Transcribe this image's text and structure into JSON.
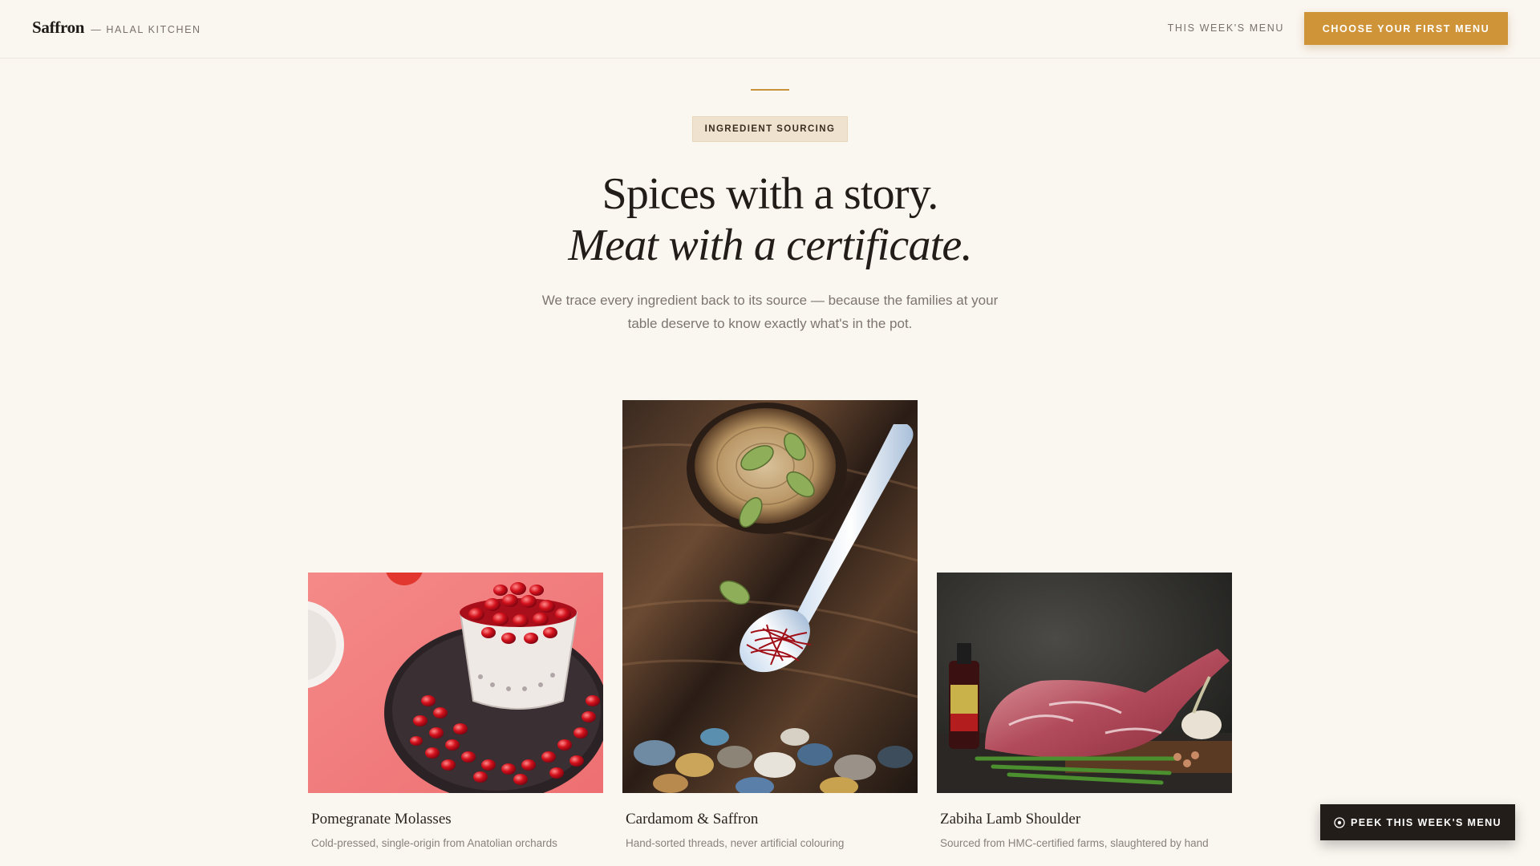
{
  "header": {
    "brand": "Saffron",
    "tagline": "— HALAL KITCHEN",
    "nav_link": "THIS WEEK'S MENU",
    "cta": "CHOOSE YOUR FIRST MENU"
  },
  "hero": {
    "badge": "INGREDIENT SOURCING",
    "headline_line1": "Spices with a story.",
    "headline_line2": "Meat with a certificate.",
    "lede": "We trace every ingredient back to its source — because the families at your table deserve to know exactly what's in the pot."
  },
  "cards": [
    {
      "title": "Pomegranate Molasses",
      "description": "Cold-pressed, single-origin from Anatolian orchards",
      "photo": "pomegranate-seeds-photo"
    },
    {
      "title": "Cardamom & Saffron",
      "description": "Hand-sorted threads, never artificial colouring",
      "photo": "cardamom-saffron-spoon-photo"
    },
    {
      "title": "Zabiha Lamb Shoulder",
      "description": "Sourced from HMC-certified farms, slaughtered by hand",
      "photo": "raw-lamb-shoulder-photo"
    }
  ],
  "floating_cta": {
    "label": "PEEK THIS WEEK'S MENU",
    "icon": "play-circle-icon"
  },
  "colors": {
    "background": "#faf6f0",
    "accent": "#cf9438",
    "dark": "#231d19"
  }
}
